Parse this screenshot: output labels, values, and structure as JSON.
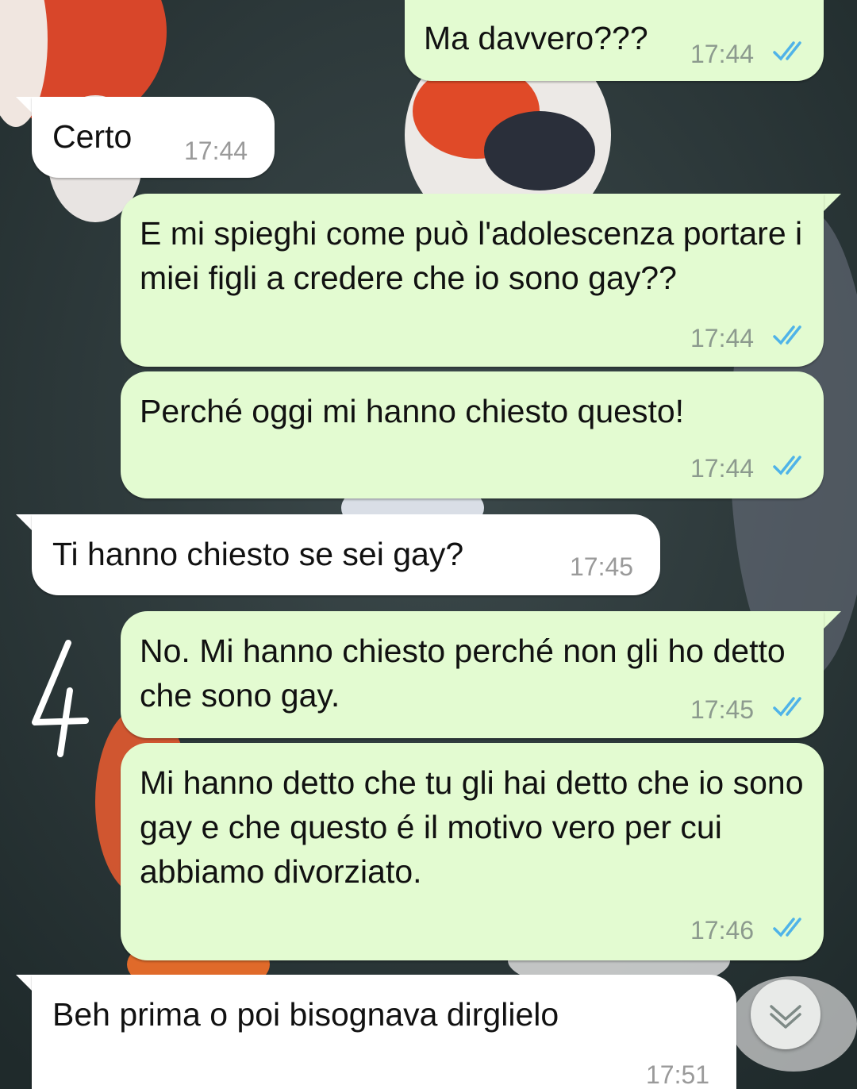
{
  "chat": {
    "messages": [
      {
        "direction": "out",
        "text": "Ma davvero???",
        "time": "17:44",
        "status": "read"
      },
      {
        "direction": "in",
        "text": "Certo",
        "time": "17:44"
      },
      {
        "direction": "out",
        "text": "E mi spieghi come può l'adolescenza portare i miei figli a credere che io sono gay??",
        "time": "17:44",
        "status": "read"
      },
      {
        "direction": "out",
        "text": "Perché oggi mi hanno chiesto questo!",
        "time": "17:44",
        "status": "read"
      },
      {
        "direction": "in",
        "text": "Ti hanno chiesto se sei gay?",
        "time": "17:45"
      },
      {
        "direction": "out",
        "text": "No. Mi hanno chiesto perché non gli ho detto che sono gay.",
        "time": "17:45",
        "status": "read"
      },
      {
        "direction": "out",
        "text": "Mi hanno detto che tu gli hai detto che io sono gay e che questo é il motivo vero per cui abbiamo divorziato.",
        "time": "17:46",
        "status": "read"
      },
      {
        "direction": "in",
        "text": "Beh prima o poi bisognava dirglielo",
        "time": "17:51"
      }
    ]
  },
  "annotation": {
    "number": "4"
  },
  "icons": {
    "read_ticks": "double-check-icon",
    "scroll": "chevron-double-down-icon"
  },
  "colors": {
    "outgoing": "#e3fbd1",
    "incoming": "#ffffff",
    "read_tick": "#4fb3e8",
    "time": "#8c9a8e"
  }
}
